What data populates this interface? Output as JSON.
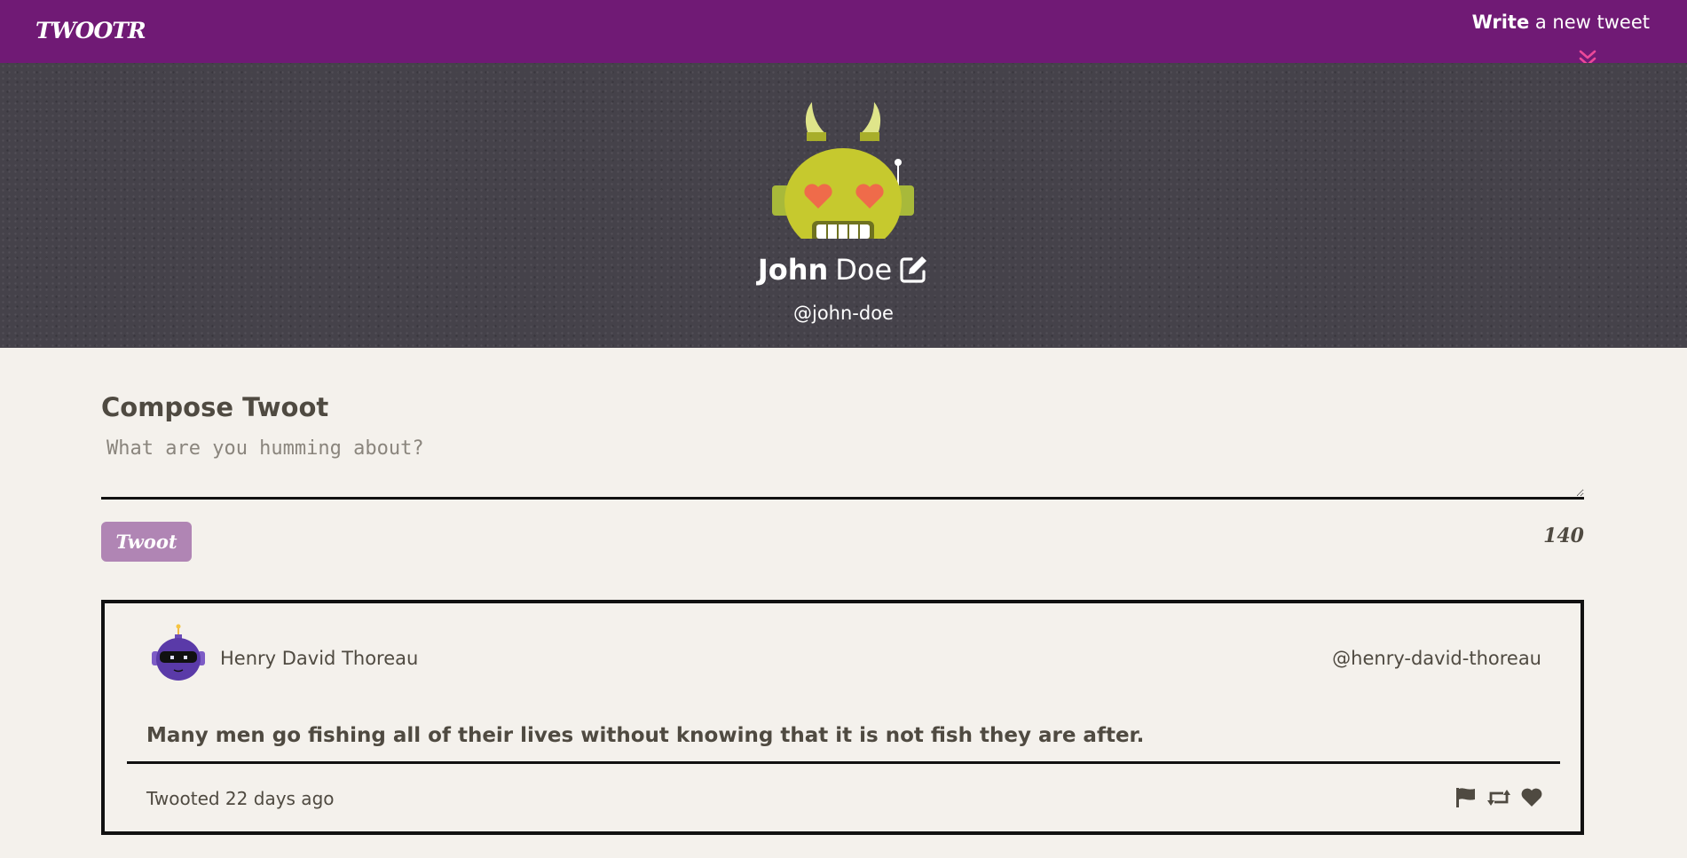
{
  "navbar": {
    "logo": "TWOOTR",
    "write_bold": "Write",
    "write_rest": " a new tweet"
  },
  "profile": {
    "first_name": "John",
    "last_name": "Doe",
    "handle": "@john-doe"
  },
  "compose": {
    "title": "Compose Twoot",
    "placeholder": "What are you humming about?",
    "button_label": "Twoot",
    "char_count": "140"
  },
  "tweets": [
    {
      "name": "Henry David Thoreau",
      "handle": "@henry-david-thoreau",
      "content": "Many men go fishing all of their lives without knowing that it is not fish they are after.",
      "time": "Twooted 22 days ago"
    }
  ],
  "colors": {
    "nav_bg": "#701a75",
    "hero_bg": "#45424a",
    "page_bg": "#f4f1ec",
    "button_bg": "#b085b4",
    "chevron": "#ec4899",
    "text": "#4f4a41"
  },
  "icons": {
    "chevron": "double-chevron-down-icon",
    "edit": "edit-icon",
    "flag": "flag-icon",
    "retweet": "retweet-icon",
    "like": "heart-icon"
  }
}
